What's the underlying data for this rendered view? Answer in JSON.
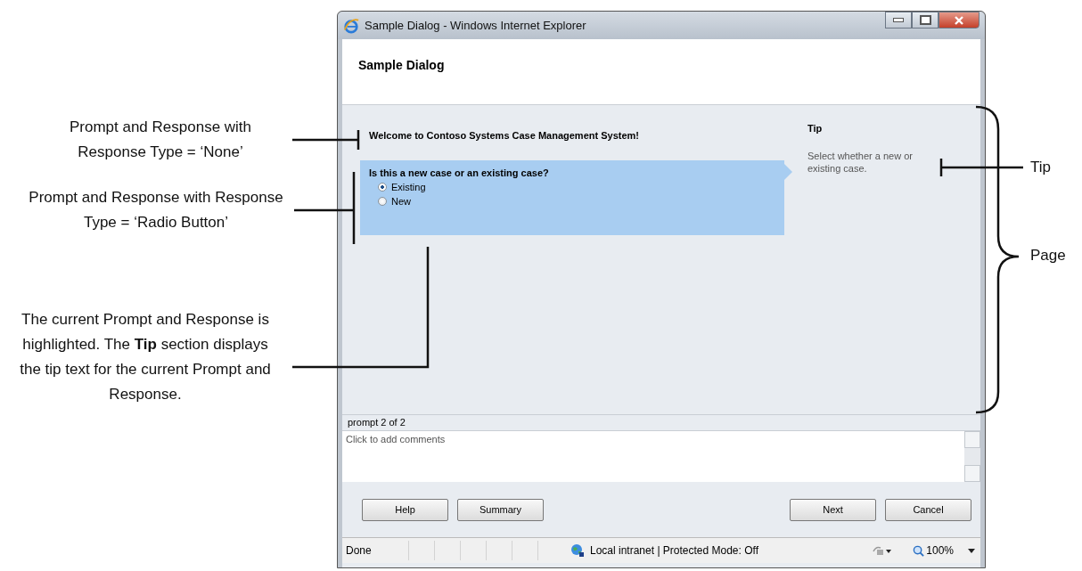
{
  "window": {
    "title": "Sample Dialog - Windows Internet Explorer"
  },
  "dialog": {
    "title": "Sample Dialog"
  },
  "prompts": [
    {
      "kind": "none",
      "text": "Welcome to Contoso Systems Case Management System!",
      "highlighted": false
    },
    {
      "kind": "radio",
      "text": "Is this a new case or an existing case?",
      "highlighted": true,
      "options": [
        {
          "label": "Existing",
          "selected": true
        },
        {
          "label": "New",
          "selected": false
        }
      ]
    }
  ],
  "tip": {
    "heading": "Tip",
    "text": "Select whether a new or existing case."
  },
  "prompt_counter": "prompt 2 of 2",
  "comments": {
    "placeholder": "Click to add comments"
  },
  "buttons_left": [
    "Help",
    "Summary"
  ],
  "buttons_right": [
    "Next",
    "Cancel"
  ],
  "status_bar": {
    "status": "Done",
    "zone": "Local intranet | Protected Mode: Off",
    "zoom": "100%"
  },
  "annotations": [
    {
      "text": "Prompt and Response with Response Type = ‘None’"
    },
    {
      "text": "Prompt and Response with Response Type = ‘Radio Button’"
    },
    {
      "text": "The current Prompt and Response is highlighted. The **Tip** section displays the tip text for the current Prompt and Response."
    },
    {
      "text": "Tip"
    },
    {
      "text": "Page"
    }
  ]
}
